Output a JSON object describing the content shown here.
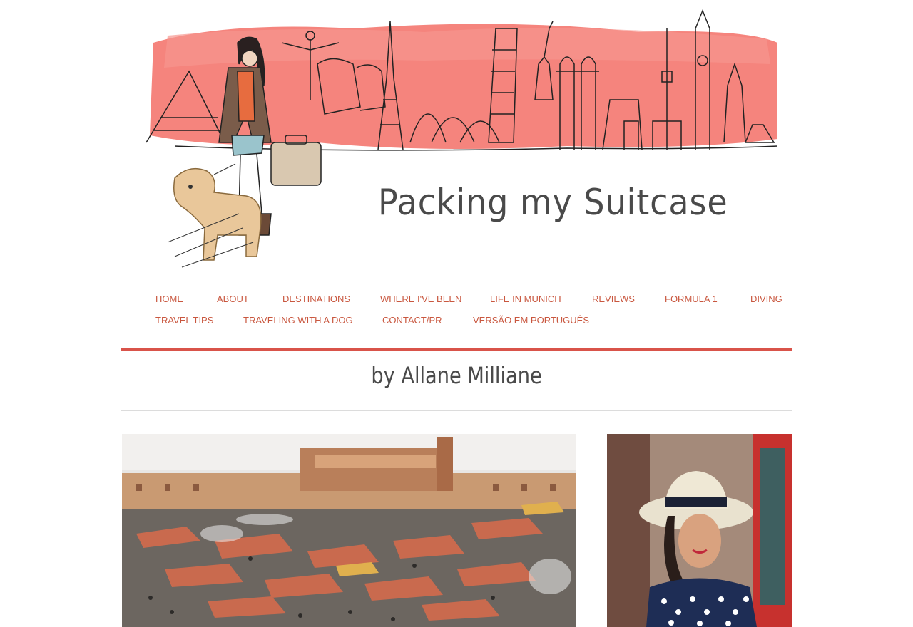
{
  "site": {
    "title": "Packing my Suitcase",
    "byline": "by Allane Milliane",
    "accent_color": "#d9534a",
    "nav_color": "#c9573f"
  },
  "nav": {
    "row1": [
      {
        "label": "HOME"
      },
      {
        "label": "ABOUT"
      },
      {
        "label": "DESTINATIONS"
      },
      {
        "label": "WHERE I'VE BEEN"
      },
      {
        "label": "LIFE IN MUNICH"
      },
      {
        "label": "REVIEWS"
      },
      {
        "label": "FORMULA 1"
      },
      {
        "label": "DIVING"
      }
    ],
    "row2": [
      {
        "label": "TRAVEL TIPS"
      },
      {
        "label": "TRAVELING WITH A DOG"
      },
      {
        "label": "CONTACT/PR"
      },
      {
        "label": "VERSÃO EM PORTUGUÊS"
      }
    ]
  },
  "featured": [
    {
      "image": "marrakech-market-square-photo"
    },
    {
      "image": "woman-in-straw-hat-photo"
    }
  ]
}
